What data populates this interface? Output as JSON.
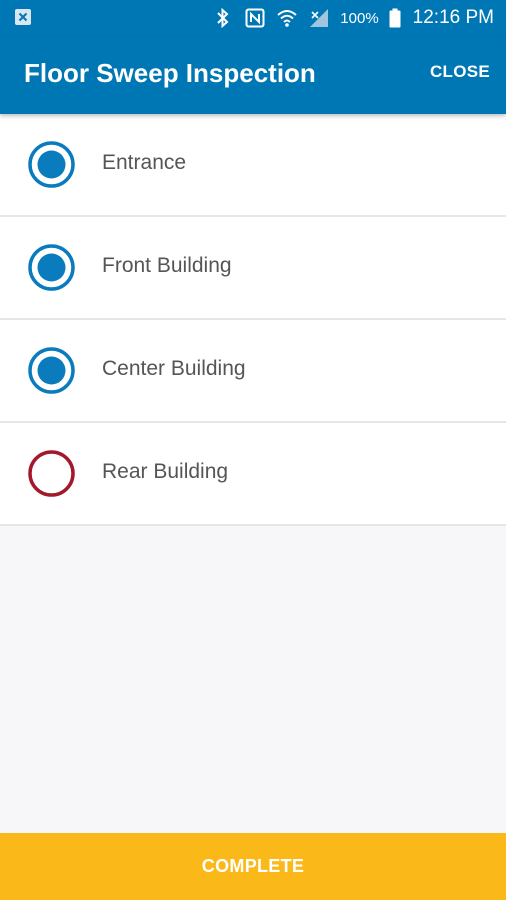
{
  "status_bar": {
    "battery_percent": "100%",
    "time": "12:16 PM",
    "icons": [
      "notification-icon",
      "bluetooth-icon",
      "nfc-icon",
      "wifi-icon",
      "signal-icon",
      "battery-icon"
    ]
  },
  "header": {
    "title": "Floor Sweep Inspection",
    "close_label": "CLOSE"
  },
  "checklist": {
    "items": [
      {
        "label": "Entrance",
        "checked": true
      },
      {
        "label": "Front Building",
        "checked": true
      },
      {
        "label": "Center Building",
        "checked": true
      },
      {
        "label": "Rear Building",
        "checked": false
      }
    ]
  },
  "footer": {
    "complete_label": "COMPLETE"
  },
  "colors": {
    "primary": "#0077b5",
    "checked": "#0a7bbd",
    "unchecked": "#a3182b",
    "accent": "#fbb819"
  }
}
